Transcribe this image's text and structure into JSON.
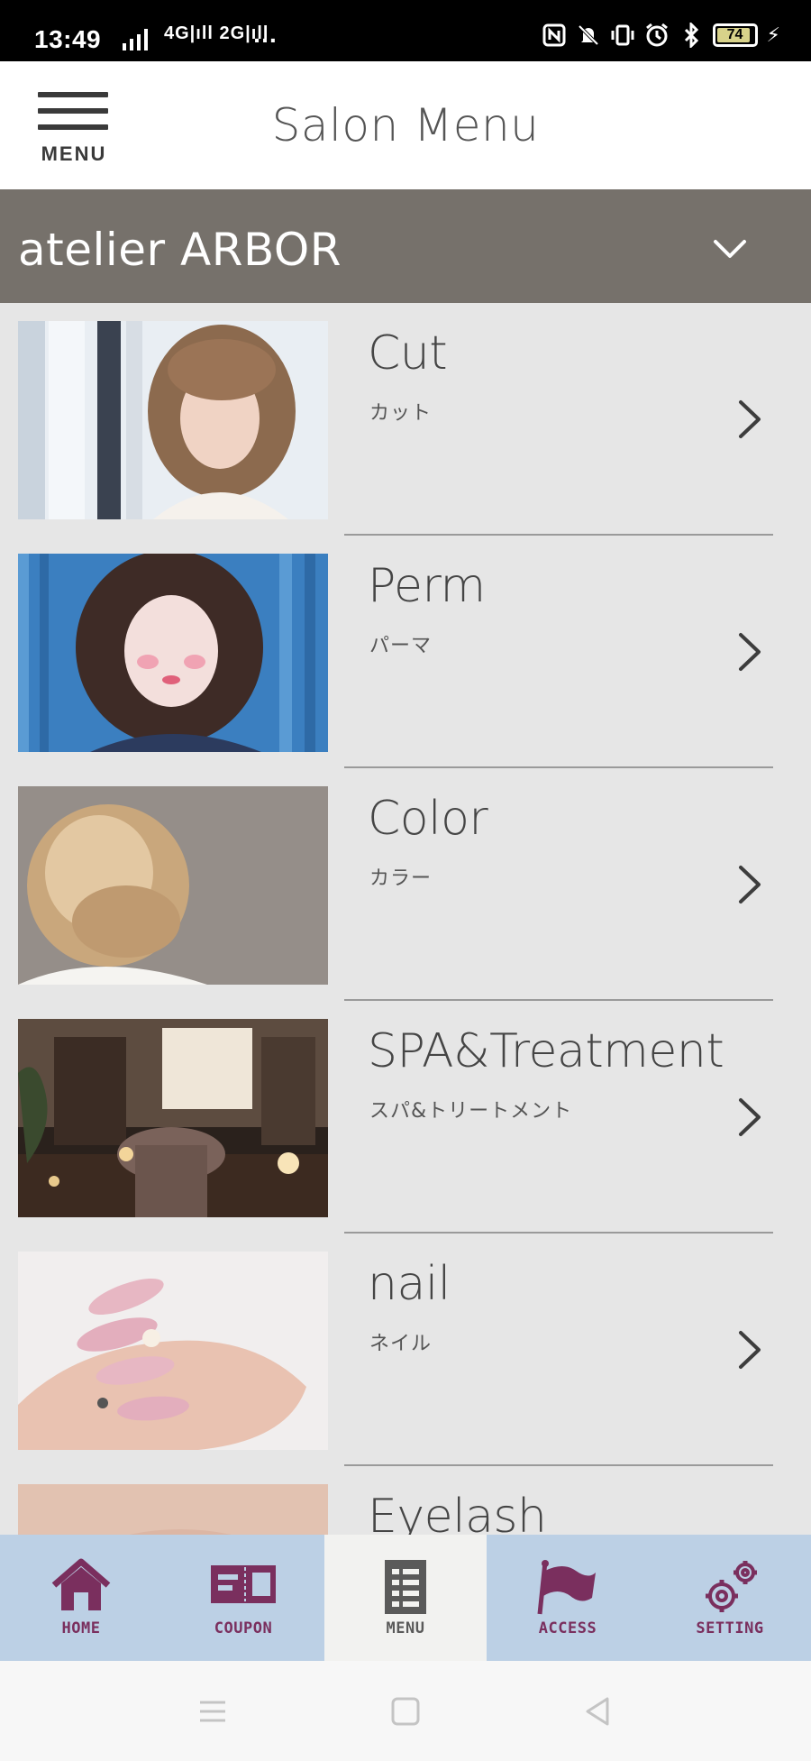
{
  "status_bar": {
    "time": "13:49",
    "network_text": "4G|ıll 2G|ıll",
    "overflow_dots": "…",
    "battery_level": "74",
    "icons": [
      "nfc-icon",
      "mute-icon",
      "vibrate-icon",
      "alarm-icon",
      "bluetooth-icon",
      "battery-icon",
      "charging-icon"
    ]
  },
  "header": {
    "menu_label": "MENU",
    "title": "Salon Menu"
  },
  "salon_selector": {
    "name": "atelier ARBOR",
    "icon": "chevron-down-icon"
  },
  "menu_items": [
    {
      "title": "Cut",
      "subtitle": "カット",
      "image": "woman-wavy-bob-photo"
    },
    {
      "title": "Perm",
      "subtitle": "パーマ",
      "image": "woman-curly-hair-blue-wall-photo"
    },
    {
      "title": "Color",
      "subtitle": "カラー",
      "image": "blonde-bob-back-view-photo"
    },
    {
      "title": "SPA&Treatment",
      "subtitle": "スパ&トリートメント",
      "image": "salon-spa-interior-photo"
    },
    {
      "title": "nail",
      "subtitle": "ネイル",
      "image": "pink-nails-hand-photo"
    },
    {
      "title": "Eyelash",
      "subtitle": "",
      "image": "eyelash-closeup-photo"
    }
  ],
  "tabbar": {
    "items": [
      {
        "label": "HOME",
        "icon": "home-icon"
      },
      {
        "label": "COUPON",
        "icon": "coupon-icon"
      },
      {
        "label": "MENU",
        "icon": "menu-list-icon",
        "active": true
      },
      {
        "label": "ACCESS",
        "icon": "flag-icon"
      },
      {
        "label": "SETTING",
        "icon": "gear-icon"
      }
    ],
    "accent_color": "#7a2f5e",
    "background_color": "#bcd0e5"
  },
  "colors": {
    "salon_bar": "#76716b",
    "list_background": "#e6e6e6"
  }
}
